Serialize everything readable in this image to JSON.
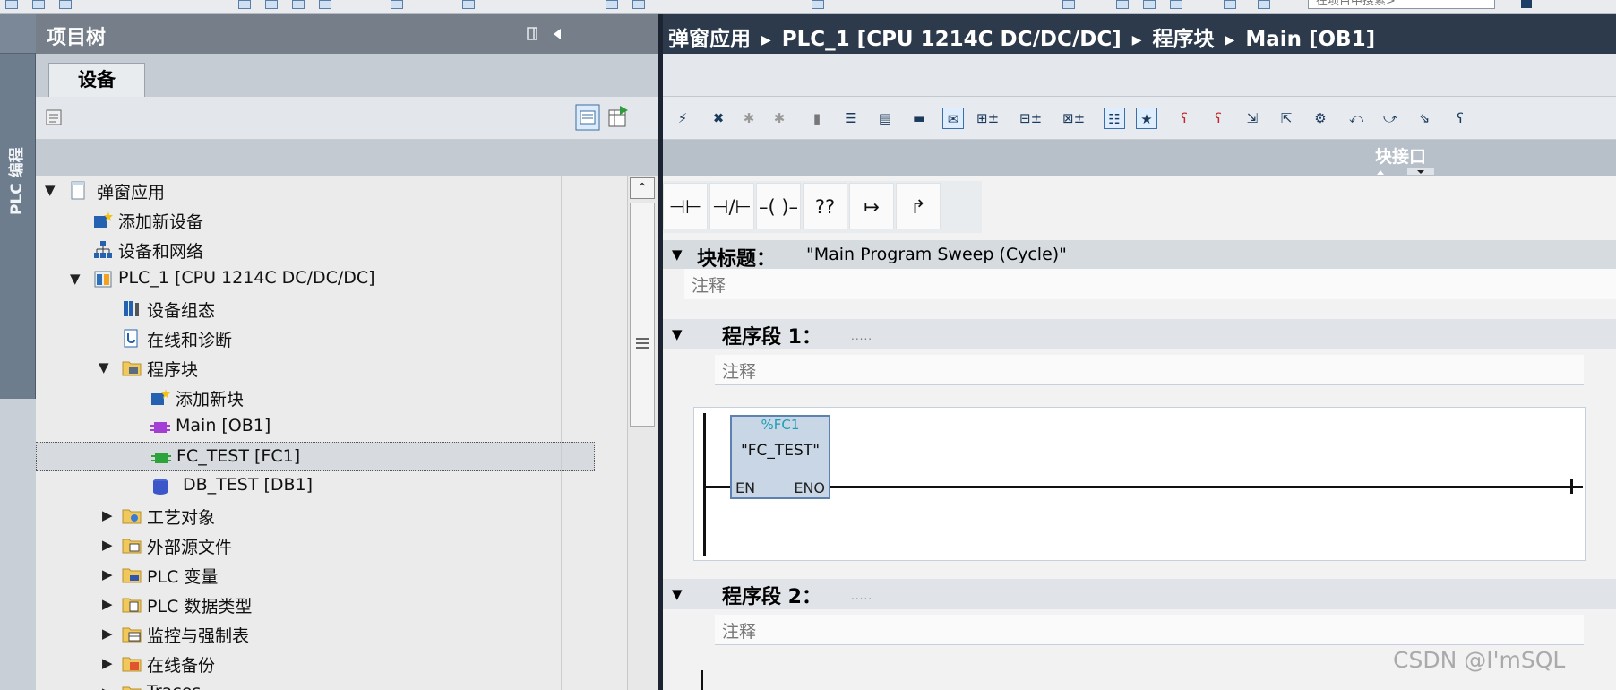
{
  "top_bar": {
    "search_placeholder": "在项目中搜索>"
  },
  "left_vertical_tab": {
    "label": "PLC 编程"
  },
  "project_tree": {
    "title": "项目树",
    "tab": "设备",
    "items": [
      {
        "label": "弹窗应用",
        "icon": "project-icon",
        "toggle": "▼"
      },
      {
        "label": "添加新设备",
        "icon": "add-device-icon",
        "toggle": ""
      },
      {
        "label": "设备和网络",
        "icon": "network-icon",
        "toggle": ""
      },
      {
        "label": "PLC_1 [CPU 1214C DC/DC/DC]",
        "icon": "plc-icon",
        "toggle": "▼"
      },
      {
        "label": "设备组态",
        "icon": "device-config-icon",
        "toggle": ""
      },
      {
        "label": "在线和诊断",
        "icon": "online-diagnostics-icon",
        "toggle": ""
      },
      {
        "label": "程序块",
        "icon": "folder-icon",
        "toggle": "▼"
      },
      {
        "label": "添加新块",
        "icon": "add-block-icon",
        "toggle": ""
      },
      {
        "label": "Main [OB1]",
        "icon": "ob-block-icon",
        "toggle": ""
      },
      {
        "label": "FC_TEST [FC1]",
        "icon": "fc-block-icon",
        "toggle": ""
      },
      {
        "label": "DB_TEST [DB1]",
        "icon": "db-block-icon",
        "toggle": ""
      },
      {
        "label": "工艺对象",
        "icon": "folder-icon",
        "toggle": "▶"
      },
      {
        "label": "外部源文件",
        "icon": "folder-icon",
        "toggle": "▶"
      },
      {
        "label": "PLC 变量",
        "icon": "folder-icon",
        "toggle": "▶"
      },
      {
        "label": "PLC 数据类型",
        "icon": "folder-icon",
        "toggle": "▶"
      },
      {
        "label": "监控与强制表",
        "icon": "folder-icon",
        "toggle": "▶"
      },
      {
        "label": "在线备份",
        "icon": "folder-icon",
        "toggle": "▶"
      },
      {
        "label": "Traces",
        "icon": "folder-icon",
        "toggle": "▶"
      }
    ]
  },
  "editor": {
    "breadcrumb": [
      "弹窗应用",
      "PLC_1 [CPU 1214C DC/DC/DC]",
      "程序块",
      "Main [OB1]"
    ],
    "interface_label": "块接口",
    "favorites": [
      "⊣⊢",
      "⊣/⊢",
      "–( )–",
      "??",
      "↦",
      "↱"
    ],
    "block_title_label": "块标题：",
    "block_title_value": "\"Main Program Sweep (Cycle)\"",
    "comment_placeholder": "注释",
    "segments": [
      {
        "label": "程序段 1：",
        "dots": "....."
      },
      {
        "label": "程序段 2：",
        "dots": "....."
      }
    ],
    "fc_box": {
      "ref": "%FC1",
      "name": "\"FC_TEST\"",
      "en": "EN",
      "eno": "ENO"
    }
  },
  "watermark": "CSDN @I'mSQL",
  "colors": {
    "editor_header": "#2c3a4c",
    "tree_header": "#767f89",
    "fc_fill": "#c9d6e6",
    "fc_border": "#5d82b2",
    "fc_ref": "#1aa0b5"
  }
}
